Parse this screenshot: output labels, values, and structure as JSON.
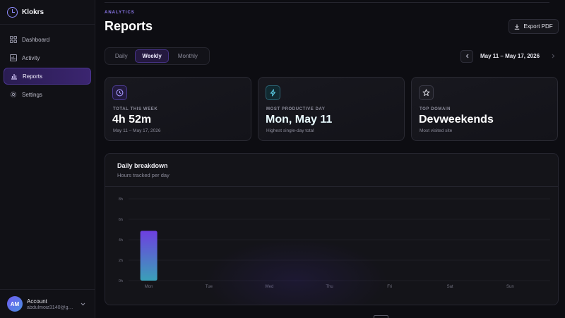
{
  "app": {
    "name": "Klokrs"
  },
  "sidebar": {
    "items": [
      {
        "label": "Dashboard",
        "icon": "grid-icon",
        "active": false
      },
      {
        "label": "Activity",
        "icon": "bar-chart-icon",
        "active": false
      },
      {
        "label": "Reports",
        "icon": "chart-icon",
        "active": true
      },
      {
        "label": "Settings",
        "icon": "gear-icon",
        "active": false
      }
    ]
  },
  "account": {
    "initials": "AM",
    "name": "Account",
    "email": "abdulmoiz3140@gm...",
    "icon": "chevron-down-icon"
  },
  "header": {
    "eyebrow": "ANALYTICS",
    "title": "Reports",
    "export_label": "Export PDF"
  },
  "tabs": [
    {
      "label": "Daily",
      "active": false
    },
    {
      "label": "Weekly",
      "active": true
    },
    {
      "label": "Monthly",
      "active": false
    }
  ],
  "date_nav": {
    "range": "May 11 – May 17, 2026",
    "prev_icon": "chevron-left-icon",
    "next_icon": "chevron-right-icon"
  },
  "stats": [
    {
      "icon": "clock-icon",
      "label": "TOTAL THIS WEEK",
      "value": "4h 52m",
      "sub": "May 11 – May 17, 2026",
      "accent": "#8b7cf6"
    },
    {
      "icon": "bolt-icon",
      "label": "MOST PRODUCTIVE DAY",
      "value": "Mon, May 11",
      "sub": "Highest single-day total",
      "accent": "#4fc3d9"
    },
    {
      "icon": "star-icon",
      "label": "TOP DOMAIN",
      "value": "Devweekends",
      "sub": "Most visited site",
      "accent": "#d6d6de"
    }
  ],
  "chart": {
    "title": "Daily breakdown",
    "subtitle": "Hours tracked per day"
  },
  "chart_data": {
    "type": "bar",
    "categories": [
      "Mon",
      "Tue",
      "Wed",
      "Thu",
      "Fri",
      "Sat",
      "Sun"
    ],
    "values": [
      4.87,
      0,
      0,
      0,
      0,
      0,
      0
    ],
    "yticks": [
      "0h",
      "2h",
      "4h",
      "6h",
      "8h"
    ],
    "ylim": [
      0,
      8
    ],
    "grid": true,
    "colors": {
      "bar_top": "#6e3fe0",
      "bar_bottom": "#3aa0b8"
    }
  },
  "colors": {
    "accent": "#8f7cf2",
    "background": "#0d0d12",
    "card": "#16161c"
  }
}
